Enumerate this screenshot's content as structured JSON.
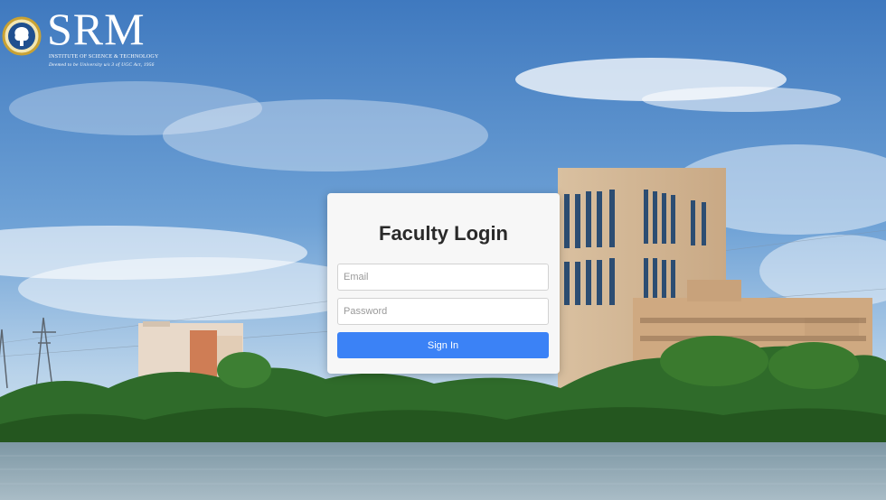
{
  "brand": {
    "name": "SRM",
    "tagline": "INSTITUTE OF SCIENCE & TECHNOLOGY",
    "subtagline": "Deemed to be University u/s 3 of UGC Act, 1956"
  },
  "login": {
    "title": "Faculty Login",
    "email_placeholder": "Email",
    "email_value": "",
    "password_placeholder": "Password",
    "password_value": "",
    "submit_label": "Sign In"
  },
  "colors": {
    "accent": "#3b82f6",
    "card_background": "#f7f7f7",
    "sky": "#4a86c8"
  },
  "icons": {
    "logo_emblem": "srm-emblem-icon"
  }
}
